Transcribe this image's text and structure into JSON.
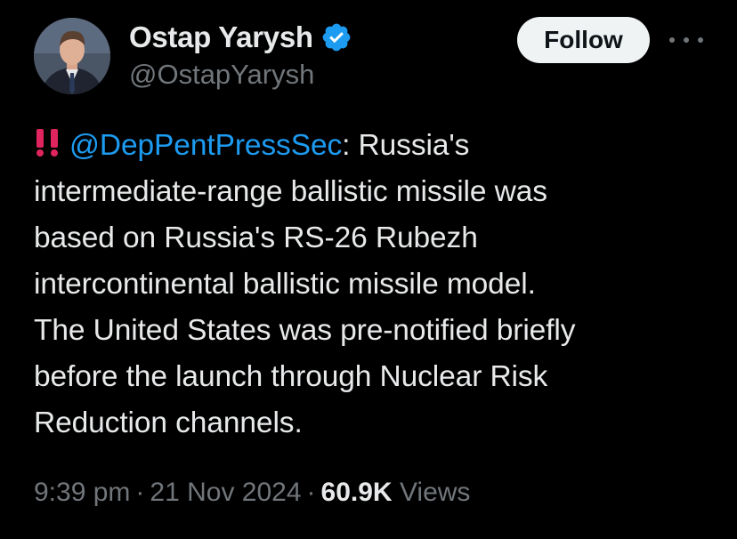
{
  "author": {
    "display_name": "Ostap Yarysh",
    "handle": "@OstapYarysh",
    "verified": true,
    "verified_color": "#1d9bf0"
  },
  "actions": {
    "follow_label": "Follow",
    "more_icon": "more-horizontal-icon"
  },
  "tweet": {
    "emoji": "double-exclamation-icon",
    "mention": "@DepPentPressSec",
    "text_after_mention": ": Russia's",
    "lines": [
      "intermediate-range ballistic missile was",
      "based on Russia's RS-26 Rubezh",
      "intercontinental ballistic missile model.",
      "The United States was pre-notified briefly",
      "before the launch through Nuclear Risk",
      "Reduction channels."
    ]
  },
  "meta": {
    "time": "9:39 pm",
    "date": "21 Nov 2024",
    "views_count": "60.9K",
    "views_label": "Views",
    "separator": "·"
  },
  "colors": {
    "background": "#000000",
    "text_primary": "#e7e9ea",
    "text_secondary": "#71767b",
    "link": "#1d9bf0",
    "emoji_red": "#e0245e"
  }
}
